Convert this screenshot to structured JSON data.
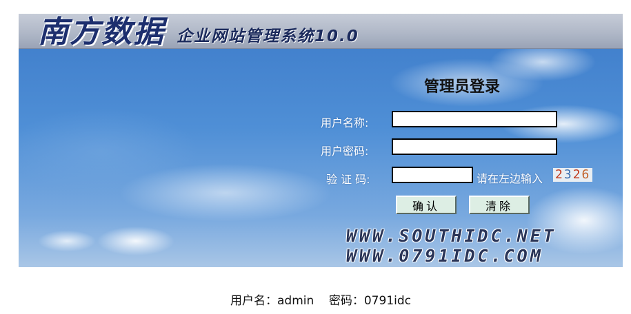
{
  "header": {
    "brand": "南方数据",
    "subtitle": "企业网站管理系统10.0"
  },
  "login": {
    "title": "管理员登录",
    "username_label": "用户名称:",
    "username_value": "",
    "password_label": "用户密码:",
    "password_value": "",
    "captcha_label": "验 证 码:",
    "captcha_value": "",
    "captcha_hint": "请在左边输入",
    "captcha_code": [
      "2",
      "3",
      "2",
      "6"
    ],
    "confirm_label": "确认",
    "clear_label": "清除"
  },
  "watermark": {
    "domain1": "WWW.SOUTHIDC.NET",
    "domain2": "WWW.0791IDC.COM"
  },
  "footer": {
    "credentials": "用户名：admin    密码：0791idc"
  },
  "colors": {
    "sky": "#4f8fd6",
    "header": "#aeb6c6",
    "button": "#ddeee4"
  }
}
